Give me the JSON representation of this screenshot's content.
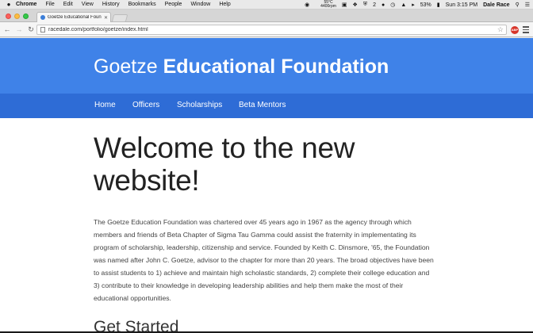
{
  "menubar": {
    "apple_icon": "apple-logo",
    "app_name": "Chrome",
    "menus": [
      "File",
      "Edit",
      "View",
      "History",
      "Bookmarks",
      "People",
      "Window",
      "Help"
    ],
    "temperature_top": "55°C",
    "temperature_bottom": "4400rpm",
    "badge_count": "2",
    "battery": "53%",
    "clock": "Sun 3:15 PM",
    "user": "Dale Race"
  },
  "browser": {
    "tab_title": "Goetze Educational Foundat",
    "url": "racedale.com/portfolio/goetze/index.html",
    "extension_label": "ABP"
  },
  "site": {
    "title_light": "Goetze",
    "title_bold": "Educational Foundation",
    "nav": {
      "home": "Home",
      "officers": "Officers",
      "scholarships": "Scholarships",
      "mentors": "Beta Mentors"
    },
    "heading": "Welcome to the new website!",
    "intro": "The Goetze Education Foundation was chartered over 45 years ago in 1967 as the agency through which members and friends of Beta Chapter of Sigma Tau Gamma could assist the fraternity in implementating its program of scholarship, leadership, citizenship and service. Founded by Keith C. Dinsmore, '65, the Foundation was named after John C. Goetze, advisor to the chapter for more than 20 years. The broad objectives have been to assist students to 1) achieve and maintain high scholastic standards, 2) complete their college education and 3) contribute to their knowledge in developing leadership abilities and help them make the most of their educational opportunities.",
    "subheading": "Get Started"
  },
  "colors": {
    "header_blue": "#3f82e8",
    "nav_blue": "#2e6cd6"
  }
}
